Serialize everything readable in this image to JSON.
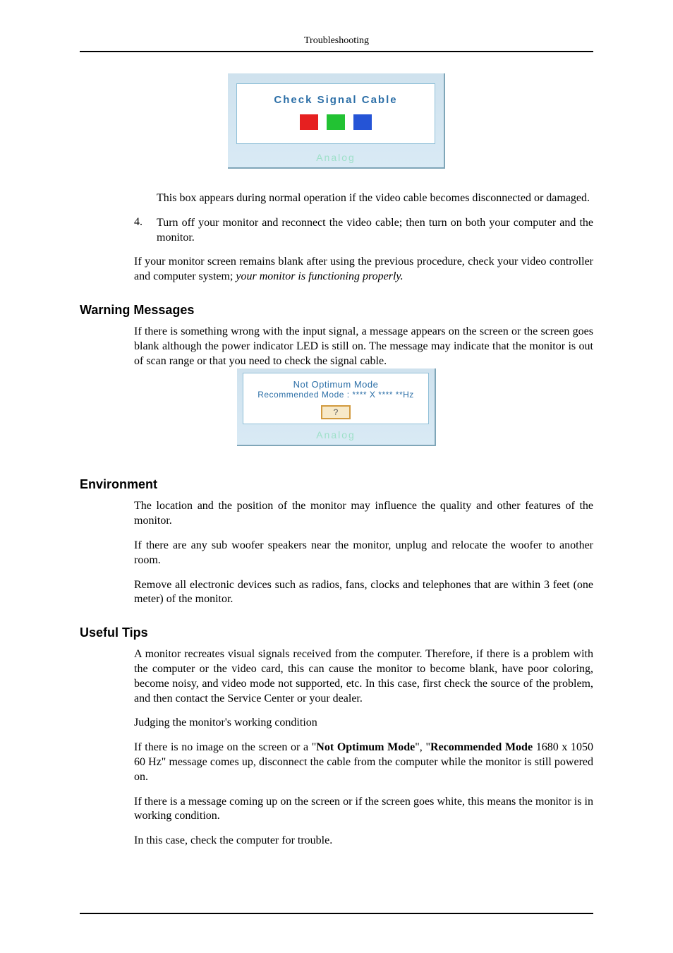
{
  "header": {
    "title": "Troubleshooting"
  },
  "fig1": {
    "title": "Check Signal Cable",
    "footer": "Analog"
  },
  "intro_after_fig1": "This box appears during normal operation if the video cable becomes disconnected or damaged.",
  "step4": {
    "num": "4.",
    "text": "Turn off your monitor and reconnect the video cable; then turn on both your computer and the monitor."
  },
  "after_step4": {
    "pre": "If your monitor screen remains blank after using the previous procedure, check your video controller and computer system; ",
    "italic": "your monitor is functioning properly."
  },
  "warning": {
    "heading": "Warning Messages",
    "p1": "If there is something wrong with the input signal, a message appears on the screen or the screen goes blank although the power indicator LED is still on. The message may indicate that the monitor is out of scan range or that you need to check the signal cable."
  },
  "fig2": {
    "line1": "Not Optimum Mode",
    "line2": "Recommended Mode : **** X **** **Hz",
    "btn": "?",
    "footer": "Analog"
  },
  "environment": {
    "heading": "Environment",
    "p1": "The location and the position of the monitor may influence the quality and other features of the monitor.",
    "p2": "If there are any sub woofer speakers near the monitor, unplug and relocate the woofer to another room.",
    "p3": "Remove all electronic devices such as radios, fans, clocks and telephones that are within 3 feet (one meter) of the monitor."
  },
  "tips": {
    "heading": "Useful Tips",
    "p1": "A monitor recreates visual signals received from the computer. Therefore, if there is a problem with the computer or the video card, this can cause the monitor to become blank, have poor coloring, become noisy, and video mode not supported, etc. In this case, first check the source of the problem, and then contact the Service Center or your dealer.",
    "p2": "Judging the monitor's working condition",
    "p3_pre": "If there is no image on the screen or a \"",
    "p3_b1": "Not Optimum Mode",
    "p3_mid": "\", \"",
    "p3_b2": "Recommended Mode",
    "p3_post": " 1680 x 1050 60 Hz\" message comes up, disconnect the cable from the computer while the monitor is still powered on.",
    "p4": "If there is a message coming up on the screen or if the screen goes white, this means the monitor is in working condition.",
    "p5": "In this case, check the computer for trouble."
  }
}
